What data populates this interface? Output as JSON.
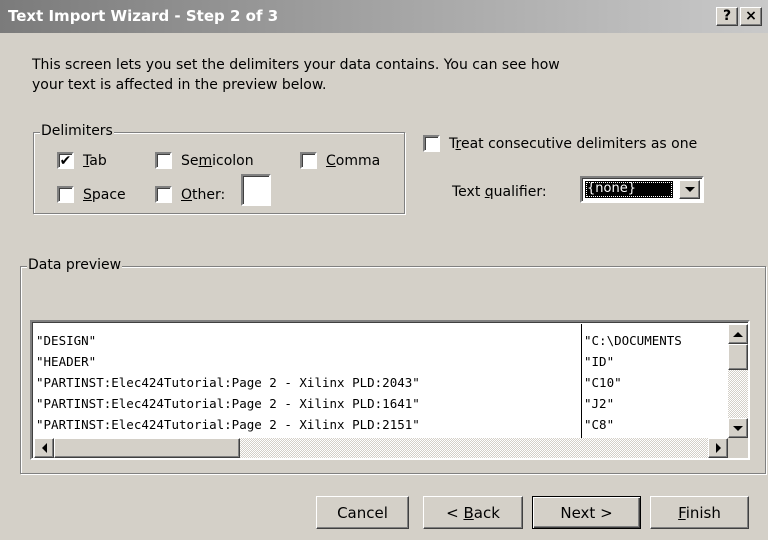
{
  "window": {
    "title": "Text Import Wizard - Step 2 of 3",
    "help_label": "?",
    "close_label": "×"
  },
  "description": "This screen lets you set the delimiters your data contains.  You can see how your text is affected in the preview below.",
  "delimiters": {
    "legend": "Delimiters",
    "tab": {
      "label": "Tab",
      "checked": true
    },
    "semicolon": {
      "label": "Semicolon",
      "checked": false
    },
    "comma": {
      "label": "Comma",
      "checked": false
    },
    "space": {
      "label": "Space",
      "checked": false
    },
    "other": {
      "label": "Other:",
      "checked": false,
      "value": ""
    }
  },
  "consecutive": {
    "label": "Treat consecutive delimiters as one",
    "checked": false
  },
  "qualifier": {
    "label": "Text qualifier:",
    "value": "{none}"
  },
  "preview": {
    "legend": "Data preview",
    "rows": [
      [
        "\"DESIGN\"",
        "\"C:\\DOCUMENTS"
      ],
      [
        "\"HEADER\"",
        "\"ID\""
      ],
      [
        "\"PARTINST:Elec424Tutorial:Page 2 - Xilinx PLD:2043\"",
        "\"C10\""
      ],
      [
        "\"PARTINST:Elec424Tutorial:Page 2 - Xilinx PLD:1641\"",
        "\"J2\""
      ],
      [
        "\"PARTINST:Elec424Tutorial:Page 2 - Xilinx PLD:2151\"",
        "\"C8\""
      ]
    ]
  },
  "buttons": {
    "cancel": "Cancel",
    "back": "< Back",
    "next": "Next >",
    "finish": "Finish"
  },
  "icons": {
    "check": "✔"
  }
}
